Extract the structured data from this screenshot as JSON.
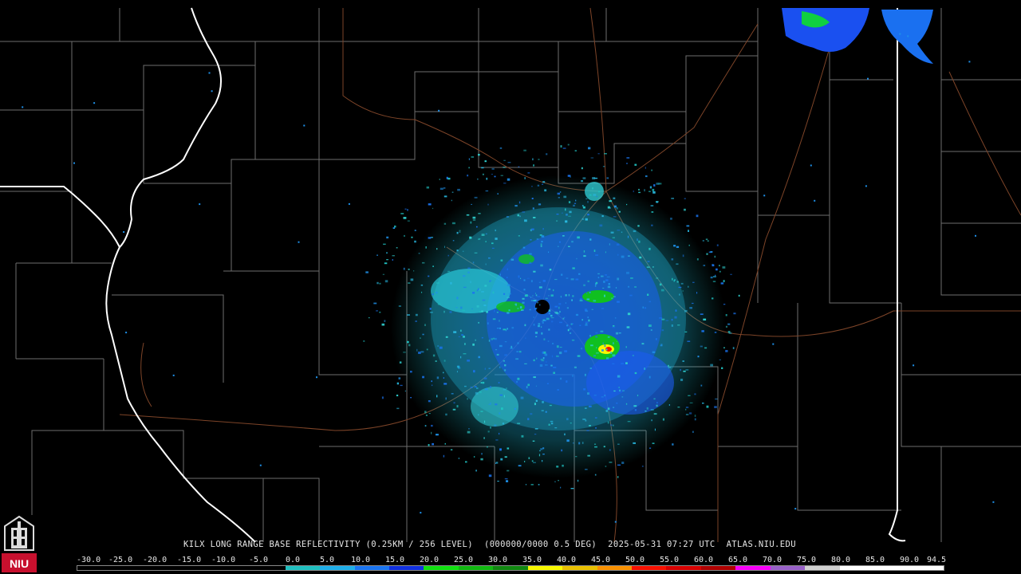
{
  "map": {
    "caption_parts": [
      "KILX LONG RANGE BASE REFLECTIVITY (0.25KM / 256 LEVEL)",
      "(000000/0000 0.5 DEG)",
      "2025-05-31 07:27 UTC",
      "ATLAS.NIU.EDU"
    ],
    "radar_site": "KILX",
    "product": "Long Range Base Reflectivity",
    "elevation": "0.5 DEG",
    "timestamp": "2025-05-31 07:27 UTC"
  },
  "legend": {
    "labels": [
      "-30.0",
      "-25.0",
      "-20.0",
      "-15.0",
      "-10.0",
      "-5.0",
      "0.0",
      "5.0",
      "10.0",
      "15.0",
      "20.0",
      "25.0",
      "30.0",
      "35.0",
      "40.0",
      "45.0",
      "50.0",
      "55.0",
      "60.0",
      "65.0",
      "70.0",
      "75.0",
      "80.0",
      "85.0",
      "90.0",
      "94.5"
    ],
    "colors": [
      "#000000",
      "#000000",
      "#000000",
      "#000000",
      "#000000",
      "#000000",
      "#20c0c0",
      "#1eaee8",
      "#1a74f0",
      "#1030e0",
      "#10e010",
      "#10b810",
      "#108810",
      "#f8f800",
      "#e8c000",
      "#f89000",
      "#f81000",
      "#d80000",
      "#b00000",
      "#f800f8",
      "#9860c8",
      "#d0d0d0",
      "#ffffff",
      "#ffffff",
      "#ffffff"
    ]
  },
  "logo": {
    "text": "NIU",
    "colors": {
      "background": "#c8102e",
      "text": "#ffffff"
    }
  },
  "colors": {
    "background": "#000000",
    "county_lines": "#7a7a7a",
    "state_lines": "#ffffff",
    "highways": "#8a4a2a",
    "radar_center": "#000000"
  }
}
